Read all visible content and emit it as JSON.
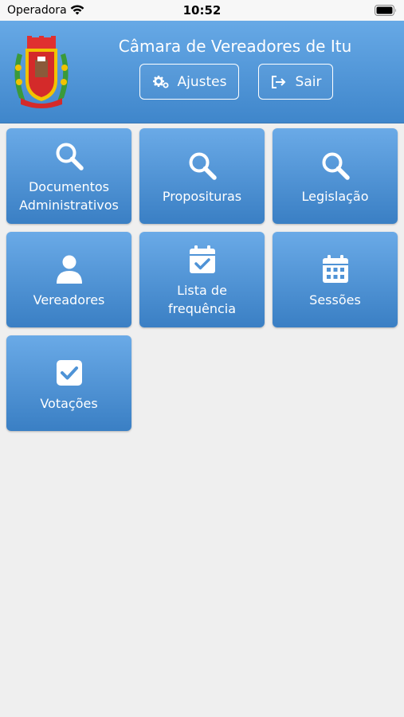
{
  "status": {
    "carrier": "Operadora",
    "time": "10:52"
  },
  "header": {
    "title": "Câmara de Vereadores de Itu",
    "settings_label": "Ajustes",
    "logout_label": "Sair"
  },
  "menu": [
    {
      "label_line1": "Documentos",
      "label_line2": "Administrativos",
      "icon": "search-icon"
    },
    {
      "label_line1": "Proposituras",
      "icon": "search-icon"
    },
    {
      "label_line1": "Legislação",
      "icon": "search-icon"
    },
    {
      "label_line1": "Vereadores",
      "icon": "user-icon"
    },
    {
      "label_line1": "Lista de",
      "label_line2": "frequência",
      "icon": "calendar-check-icon"
    },
    {
      "label_line1": "Sessões",
      "icon": "calendar-icon"
    },
    {
      "label_line1": "Votações",
      "icon": "check-square-icon"
    }
  ],
  "colors": {
    "header_top": "#67a9e6",
    "header_bottom": "#3f86cb",
    "tile_top": "#6aaae7",
    "tile_bottom": "#3a7fc4",
    "background": "#efefef"
  }
}
